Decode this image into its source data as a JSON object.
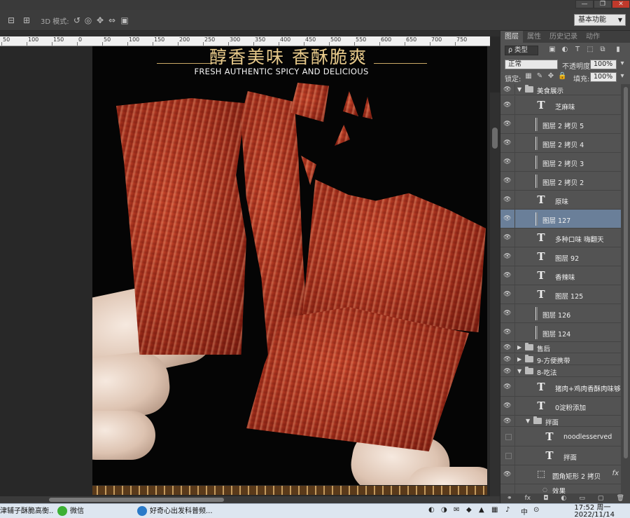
{
  "window": {
    "minimize": "—",
    "restore": "❐",
    "close": "✕"
  },
  "options_bar": {
    "mode_label": "3D 模式:",
    "workspace": "基本功能"
  },
  "ruler": {
    "ticks": [
      "50",
      "100",
      "150",
      "0",
      "50",
      "100",
      "150",
      "200",
      "250",
      "300",
      "350",
      "400",
      "450",
      "500",
      "550",
      "600",
      "650",
      "700",
      "750"
    ]
  },
  "artboard": {
    "title": "醇香美味  香酥脆爽",
    "subtitle": "FRESH  AUTHENTIC  SPICY AND DELICIOUS"
  },
  "layers_panel": {
    "tabs": [
      "图层",
      "属性",
      "历史记录",
      "动作"
    ],
    "filter_kind": "ρ 类型",
    "blend_mode": "正常",
    "opacity_label": "不透明度:",
    "opacity_value": "100%",
    "lock_label": "锁定:",
    "fill_label": "填充:",
    "fill_value": "100%",
    "layers": [
      {
        "kind": "group",
        "name": "美食展示",
        "expanded": true,
        "indent": 0
      },
      {
        "kind": "text",
        "name": "芝麻味",
        "indent": 1
      },
      {
        "kind": "pixel",
        "name": "图层 2 拷贝 5",
        "indent": 1
      },
      {
        "kind": "pixel",
        "name": "图层 2 拷贝 4",
        "indent": 1
      },
      {
        "kind": "pixel",
        "name": "图层 2 拷贝 3",
        "indent": 1
      },
      {
        "kind": "pixel",
        "name": "图层 2 拷贝 2",
        "indent": 1
      },
      {
        "kind": "text",
        "name": "原味",
        "indent": 1
      },
      {
        "kind": "pixel",
        "name": "图层 127",
        "indent": 1,
        "selected": true
      },
      {
        "kind": "text",
        "name": "多种口味 嗨翻天",
        "indent": 1
      },
      {
        "kind": "text",
        "name": "图层 92",
        "indent": 1
      },
      {
        "kind": "text",
        "name": "香辣味",
        "indent": 1
      },
      {
        "kind": "text",
        "name": "图层 125",
        "indent": 1
      },
      {
        "kind": "pixel",
        "name": "图层 126",
        "indent": 1
      },
      {
        "kind": "pixel",
        "name": "图层 124",
        "indent": 1
      },
      {
        "kind": "group",
        "name": "售后",
        "expanded": false,
        "indent": 0
      },
      {
        "kind": "group",
        "name": "9-方便携带",
        "expanded": false,
        "indent": 0
      },
      {
        "kind": "group",
        "name": "8-吃法",
        "expanded": true,
        "indent": 0
      },
      {
        "kind": "text",
        "name": "猪肉+鸡肉香酥肉味够",
        "indent": 1
      },
      {
        "kind": "text",
        "name": "0淀粉添加",
        "indent": 1
      },
      {
        "kind": "group",
        "name": "拌面",
        "expanded": true,
        "indent": 1
      },
      {
        "kind": "text",
        "name": "noodlesserved",
        "indent": 2,
        "hidden": true
      },
      {
        "kind": "text",
        "name": "拌面",
        "indent": 2,
        "hidden": true
      },
      {
        "kind": "shape",
        "name": "圆角矩形 2 拷贝",
        "indent": 2,
        "fx": true
      },
      {
        "kind": "effect",
        "name": "效果",
        "indent": 3
      }
    ],
    "bottom_icons": [
      "link-icon",
      "fx-icon",
      "mask-icon",
      "adjustment-icon",
      "folder-icon",
      "new-layer-icon",
      "trash-icon"
    ]
  },
  "taskbar": {
    "items": [
      "津辅子酥脆高衡...",
      "微信",
      "好奇心出发科普频..."
    ],
    "ime": "中",
    "time": "17:52 周一",
    "date": "2022/11/14"
  }
}
